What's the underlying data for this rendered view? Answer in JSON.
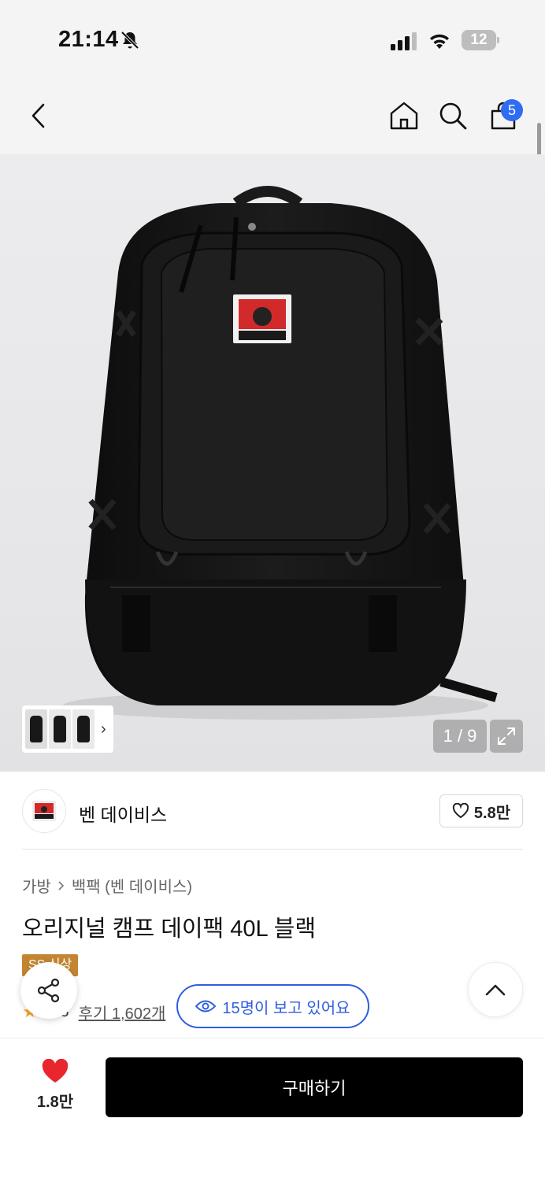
{
  "status_bar": {
    "time": "21:14",
    "battery": "12"
  },
  "header": {
    "cart_badge": "5"
  },
  "gallery": {
    "counter": "1 / 9"
  },
  "brand": {
    "name": "벤 데이비스",
    "likes": "5.8만",
    "logo_text": "BEN DAVIS"
  },
  "breadcrumb": {
    "category": "가방",
    "subcategory": "백팩 (벤 데이비스)"
  },
  "product": {
    "title": "오리지널 캠프 데이팩 40L 블랙",
    "tag": "SS 신상",
    "rating": "4.8",
    "reviews": "후기 1,602개"
  },
  "viewers": {
    "label": "15명이 보고 있어요"
  },
  "bottom_bar": {
    "wish_count": "1.8만",
    "buy_label": "구매하기"
  },
  "colors": {
    "accent_blue": "#2f5ee0",
    "badge_blue": "#2f6cf2",
    "tag_orange": "#c38530",
    "heart_red": "#e8262c"
  }
}
